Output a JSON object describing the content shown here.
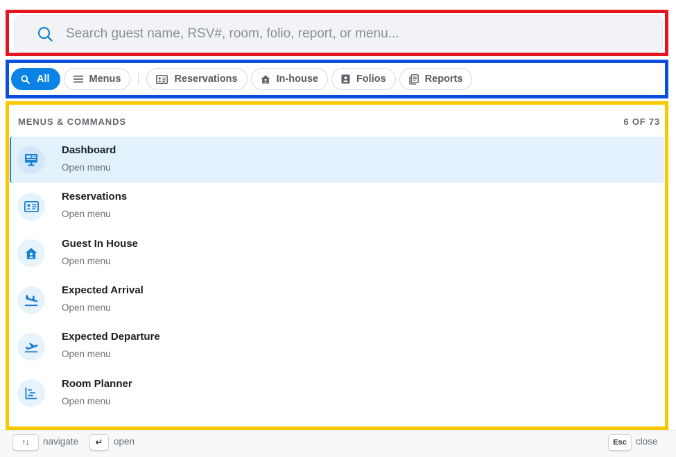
{
  "search": {
    "placeholder": "Search guest name, RSV#, room, folio, report, or menu..."
  },
  "filters": [
    {
      "label": "All",
      "icon": "search-icon",
      "active": true
    },
    {
      "label": "Menus",
      "icon": "menu-icon",
      "active": false
    },
    {
      "label": "Reservations",
      "icon": "id-card-icon",
      "active": false
    },
    {
      "label": "In-house",
      "icon": "house-icon",
      "active": false
    },
    {
      "label": "Folios",
      "icon": "contact-book-icon",
      "active": false
    },
    {
      "label": "Reports",
      "icon": "report-icon",
      "active": false
    }
  ],
  "section": {
    "title": "MENUS & COMMANDS",
    "count": "6 OF 73"
  },
  "items": [
    {
      "title": "Dashboard",
      "subtitle": "Open menu",
      "icon": "monitor-icon",
      "selected": true
    },
    {
      "title": "Reservations",
      "subtitle": "Open menu",
      "icon": "id-card-icon",
      "selected": false
    },
    {
      "title": "Guest In House",
      "subtitle": "Open menu",
      "icon": "house-user-icon",
      "selected": false
    },
    {
      "title": "Expected Arrival",
      "subtitle": "Open menu",
      "icon": "plane-landing-icon",
      "selected": false
    },
    {
      "title": "Expected Departure",
      "subtitle": "Open menu",
      "icon": "plane-departure-icon",
      "selected": false
    },
    {
      "title": "Room Planner",
      "subtitle": "Open menu",
      "icon": "gantt-chart-icon",
      "selected": false
    }
  ],
  "footer": {
    "navigate_key": "↑↓",
    "navigate_label": "navigate",
    "open_key": "↵",
    "open_label": "open",
    "close_key": "Esc",
    "close_label": "close"
  },
  "colors": {
    "accent": "#0b82e6",
    "selected_bg": "#e3f1fc",
    "icon_color": "#1a7fd0",
    "annotation_red": "#e3161f",
    "annotation_blue": "#0a4fdc",
    "annotation_yellow": "#f6c800"
  }
}
